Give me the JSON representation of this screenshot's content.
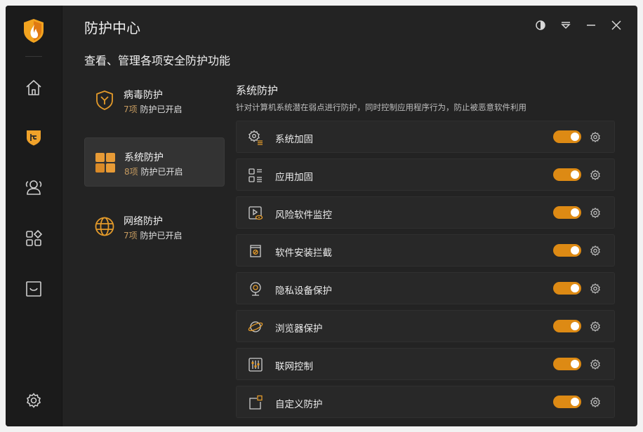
{
  "app": {
    "title": "防护中心",
    "subtitle": "查看、管理各项安全防护功能",
    "accent_color": "#dd8a14"
  },
  "sidebar": {
    "items": [
      {
        "name": "home-icon",
        "active": false
      },
      {
        "name": "shield-plus-icon",
        "active": true
      },
      {
        "name": "users-icon",
        "active": false
      },
      {
        "name": "apps-icon",
        "active": false
      },
      {
        "name": "tray-icon",
        "active": false
      },
      {
        "name": "settings-icon",
        "active": false
      }
    ]
  },
  "window_controls": [
    "theme-icon",
    "menu-icon",
    "minimize-icon",
    "close-icon"
  ],
  "categories": [
    {
      "name": "病毒防护",
      "count": "7项",
      "status": "防护已开启",
      "icon": "virus-shield-icon",
      "active": false
    },
    {
      "name": "系统防护",
      "count": "8项",
      "status": "防护已开启",
      "icon": "system-grid-icon",
      "active": true
    },
    {
      "name": "网络防护",
      "count": "7项",
      "status": "防护已开启",
      "icon": "globe-icon",
      "active": false
    }
  ],
  "section": {
    "title": "系统防护",
    "description": "针对计算机系统潜在弱点进行防护，同时控制应用程序行为，防止被恶意软件利用"
  },
  "features": [
    {
      "label": "系统加固",
      "icon": "gear-list-icon",
      "enabled": true
    },
    {
      "label": "应用加固",
      "icon": "app-list-icon",
      "enabled": true
    },
    {
      "label": "风险软件监控",
      "icon": "video-eye-icon",
      "enabled": true
    },
    {
      "label": "软件安装拦截",
      "icon": "box-block-icon",
      "enabled": true
    },
    {
      "label": "隐私设备保护",
      "icon": "webcam-icon",
      "enabled": true
    },
    {
      "label": "浏览器保护",
      "icon": "planet-icon",
      "enabled": true
    },
    {
      "label": "联网控制",
      "icon": "sliders-icon",
      "enabled": true
    },
    {
      "label": "自定义防护",
      "icon": "custom-square-icon",
      "enabled": true
    }
  ]
}
